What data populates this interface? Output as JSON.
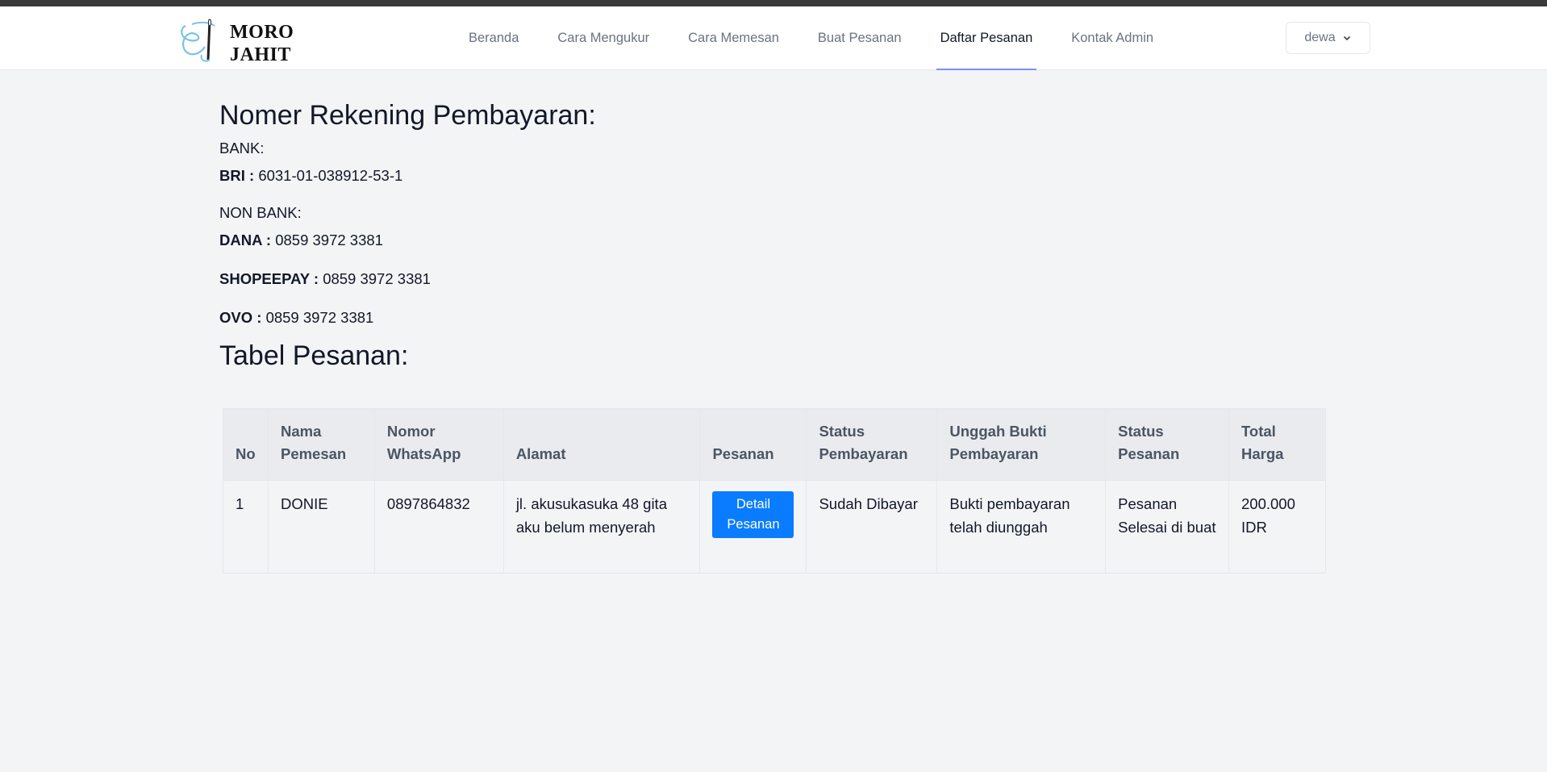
{
  "brand": {
    "name_line1": "MORO",
    "name_line2": "JAHIT"
  },
  "nav": {
    "items": [
      {
        "label": "Beranda",
        "active": false
      },
      {
        "label": "Cara Mengukur",
        "active": false
      },
      {
        "label": "Cara Memesan",
        "active": false
      },
      {
        "label": "Buat Pesanan",
        "active": false
      },
      {
        "label": "Daftar Pesanan",
        "active": true
      },
      {
        "label": "Kontak Admin",
        "active": false
      }
    ],
    "user": "dewa",
    "active_underline_color": "#818cf8"
  },
  "payment": {
    "title": "Nomer Rekening Pembayaran:",
    "bank_heading": "BANK:",
    "bri_label": "BRI :",
    "bri_value": "6031-01-038912-53-1",
    "nonbank_heading": "NON BANK:",
    "dana_label": "DANA :",
    "dana_value": "0859 3972 3381",
    "shopeepay_label": "SHOPEEPAY :",
    "shopeepay_value": "0859 3972 3381",
    "ovo_label": "OVO :",
    "ovo_value": "0859 3972 3381"
  },
  "orders": {
    "title": "Tabel Pesanan:",
    "columns": {
      "no": "No",
      "nama_l1": "Nama",
      "nama_l2": "Pemesan",
      "wa_l1": "Nomor",
      "wa_l2": "WhatsApp",
      "alamat": "Alamat",
      "pesanan": "Pesanan",
      "status_bayar_l1": "Status",
      "status_bayar_l2": "Pembayaran",
      "bukti_l1": "Unggah Bukti",
      "bukti_l2": "Pembayaran",
      "status_pesanan_l1": "Status",
      "status_pesanan_l2": "Pesanan",
      "total_l1": "Total",
      "total_l2": "Harga"
    },
    "rows": [
      {
        "no": "1",
        "nama": "DONIE",
        "wa": "0897864832",
        "alamat": "jl. akusukasuka 48 gita aku belum menyerah",
        "detail_button": "Detail Pesanan",
        "status_bayar": "Sudah Dibayar",
        "bukti": "Bukti pembayaran telah diunggah",
        "status_pesanan": "Pesanan Selesai di buat",
        "total": "200.000 IDR"
      }
    ],
    "button_color": "#0a7cff"
  }
}
